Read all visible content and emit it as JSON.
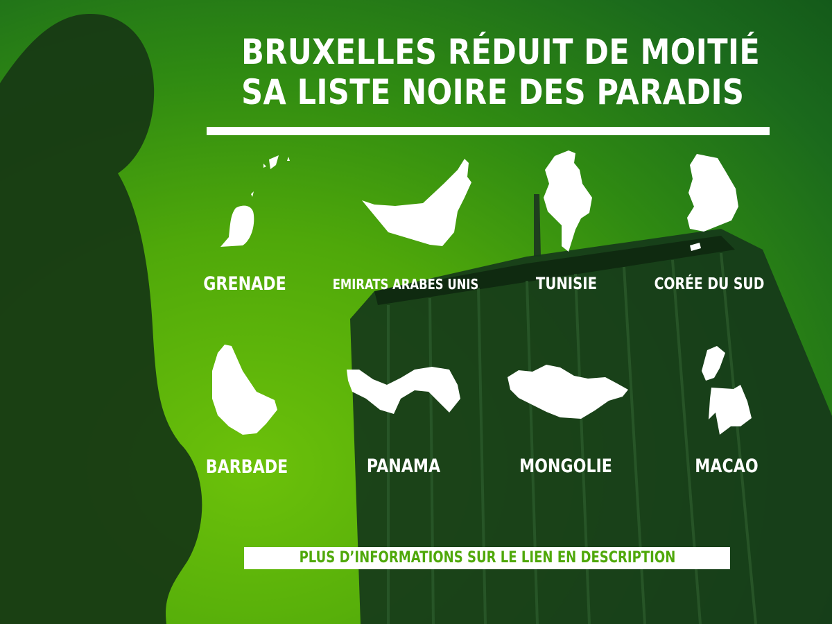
{
  "title": {
    "line1": "BRUXELLES RÉDUIT DE MOITIÉ",
    "line2": "SA LISTE NOIRE DES PARADIS"
  },
  "countries": [
    {
      "name": "GRENADE",
      "icon": "grenada-map-icon"
    },
    {
      "name": "EMIRATS ARABES UNIS",
      "icon": "uae-map-icon"
    },
    {
      "name": "TUNISIE",
      "icon": "tunisia-map-icon"
    },
    {
      "name": "CORÉE DU SUD",
      "icon": "south-korea-map-icon"
    },
    {
      "name": "BARBADE",
      "icon": "barbados-map-icon"
    },
    {
      "name": "PANAMA",
      "icon": "panama-map-icon"
    },
    {
      "name": "MONGOLIE",
      "icon": "mongolia-map-icon"
    },
    {
      "name": "MACAO",
      "icon": "macao-map-icon"
    }
  ],
  "cta": "PLUS D’INFORMATIONS SUR LE LIEN EN DESCRIPTION",
  "colors": {
    "accent": "#4fa80a",
    "text": "#ffffff",
    "dark": "#143c14"
  }
}
